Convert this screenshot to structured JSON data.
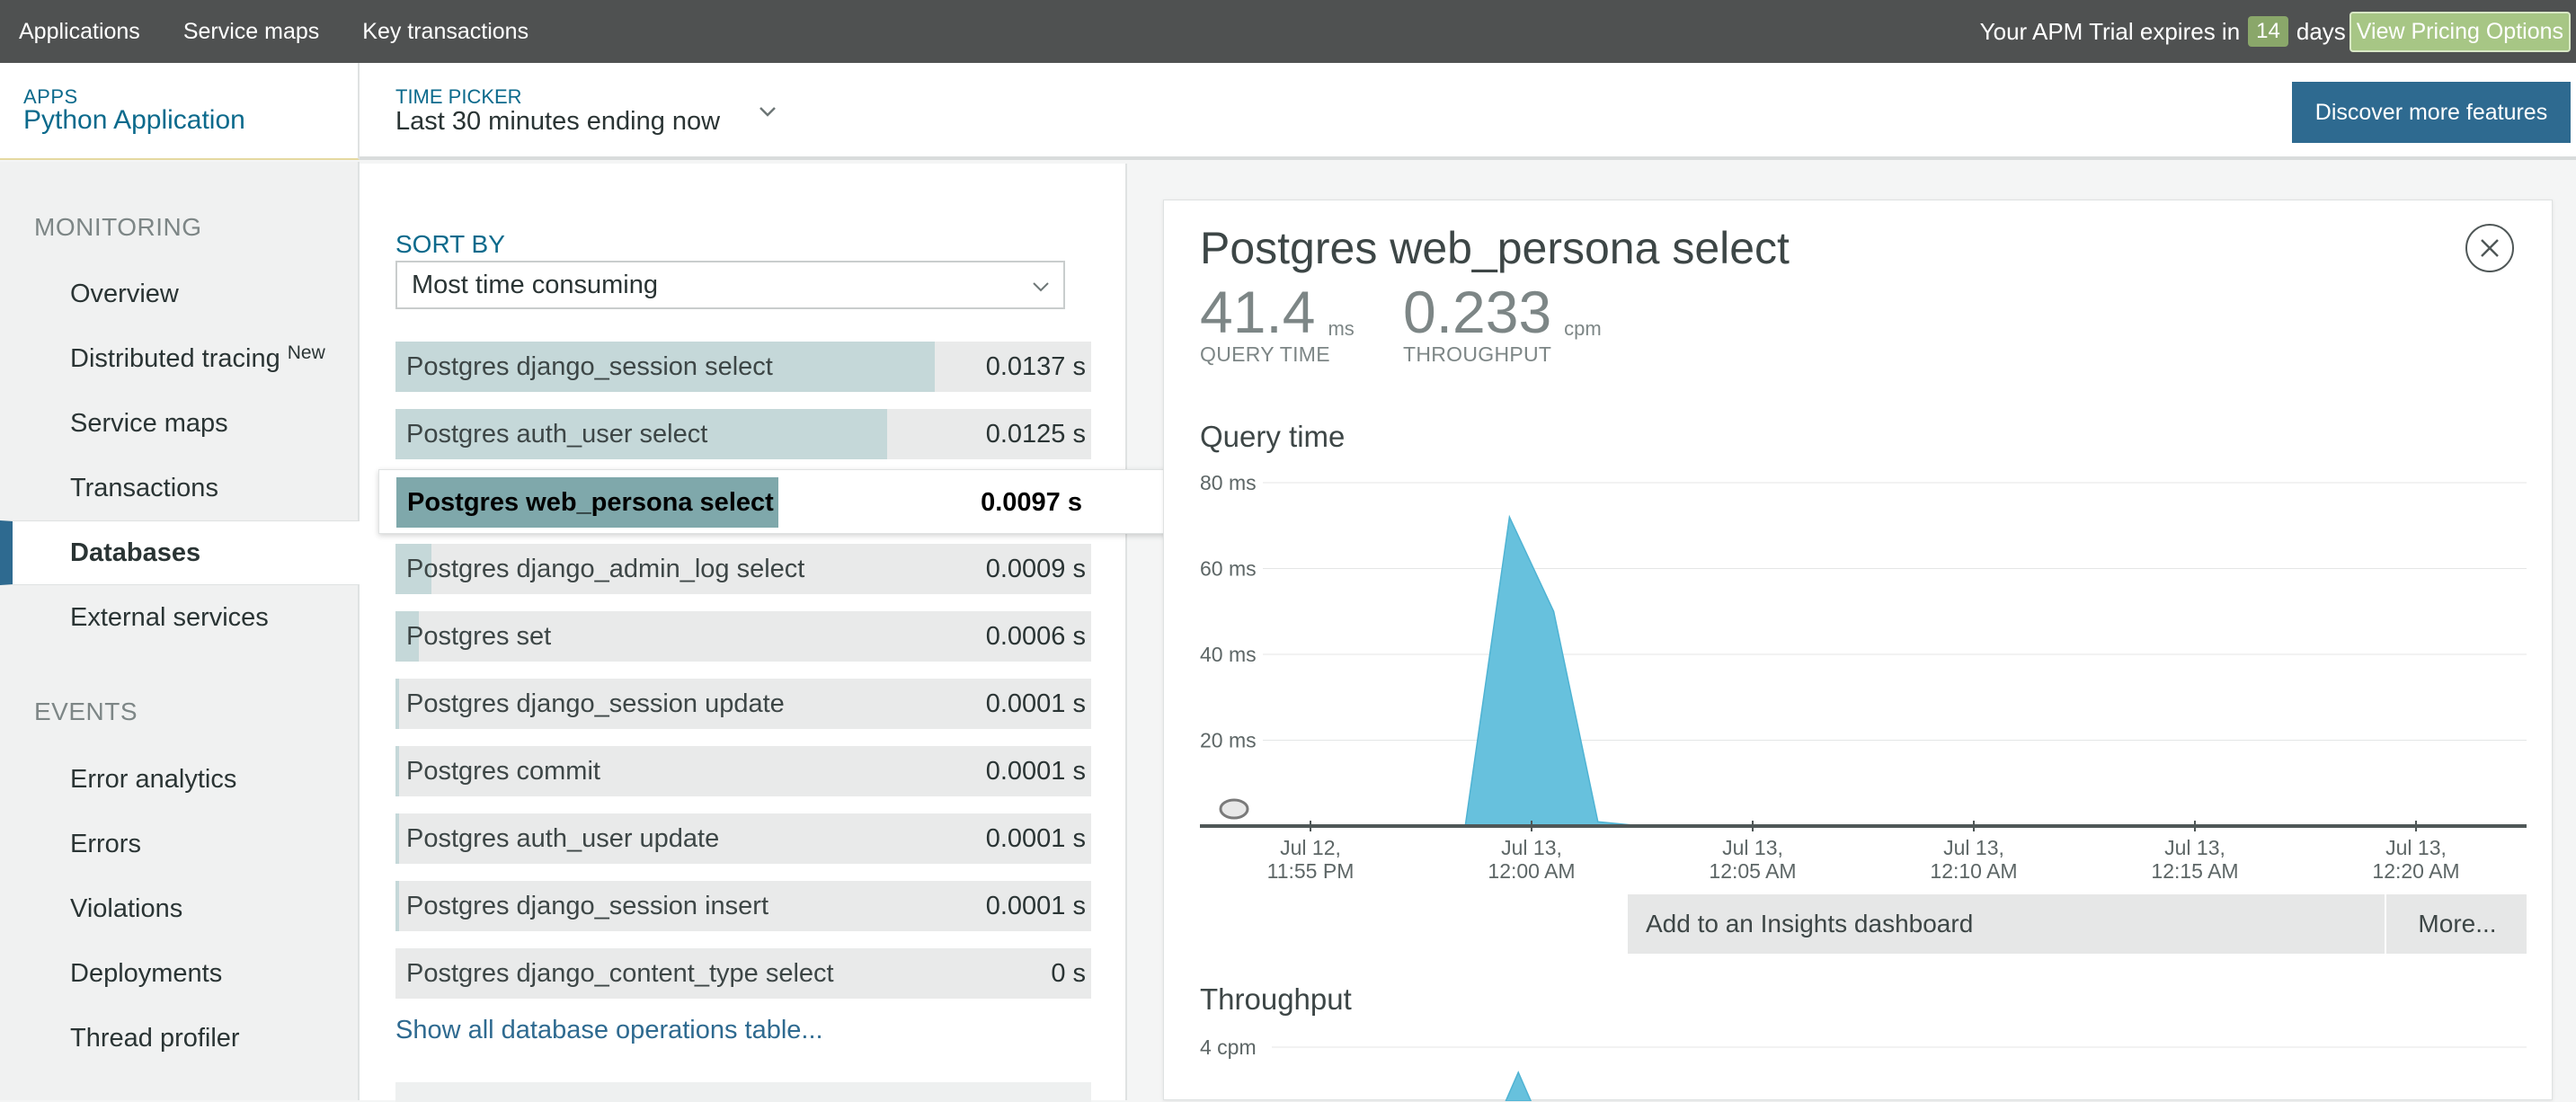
{
  "topnav": {
    "items": [
      "Applications",
      "Service maps",
      "Key transactions"
    ]
  },
  "trial": {
    "prefix": "Your APM Trial expires in",
    "days": "14",
    "suffix": "days",
    "pricing": "View Pricing Options"
  },
  "apphead": {
    "label": "APPS",
    "name": "Python Application"
  },
  "timepicker": {
    "label": "TIME PICKER",
    "value": "Last 30 minutes ending now"
  },
  "discover": "Discover more features",
  "sidebar": {
    "monitoring_label": "MONITORING",
    "monitoring": [
      {
        "label": "Overview"
      },
      {
        "label": "Distributed tracing",
        "badge": "New"
      },
      {
        "label": "Service maps"
      },
      {
        "label": "Transactions"
      },
      {
        "label": "Databases",
        "active": true
      },
      {
        "label": "External services"
      }
    ],
    "events_label": "EVENTS",
    "events": [
      {
        "label": "Error analytics"
      },
      {
        "label": "Errors"
      },
      {
        "label": "Violations"
      },
      {
        "label": "Deployments"
      },
      {
        "label": "Thread profiler"
      }
    ]
  },
  "sort": {
    "label": "SORT BY",
    "value": "Most time consuming"
  },
  "operations": [
    {
      "name": "Postgres django_session select",
      "value": "0.0137 s",
      "fraction": 1.0
    },
    {
      "name": "Postgres auth_user select",
      "value": "0.0125 s",
      "fraction": 0.912
    },
    {
      "name": "Postgres web_persona select",
      "value": "0.0097 s",
      "fraction": 0.708,
      "selected": true
    },
    {
      "name": "Postgres django_admin_log select",
      "value": "0.0009 s",
      "fraction": 0.066
    },
    {
      "name": "Postgres set",
      "value": "0.0006 s",
      "fraction": 0.044
    },
    {
      "name": "Postgres django_session update",
      "value": "0.0001 s",
      "fraction": 0.007
    },
    {
      "name": "Postgres commit",
      "value": "0.0001 s",
      "fraction": 0.007
    },
    {
      "name": "Postgres auth_user update",
      "value": "0.0001 s",
      "fraction": 0.007
    },
    {
      "name": "Postgres django_session insert",
      "value": "0.0001 s",
      "fraction": 0.007
    },
    {
      "name": "Postgres django_content_type select",
      "value": "0 s",
      "fraction": 0.0
    }
  ],
  "showall": "Show all database operations table...",
  "detail": {
    "title": "Postgres web_persona select",
    "query_time": {
      "value": "41.4",
      "unit": "ms",
      "label": "QUERY TIME"
    },
    "throughput": {
      "value": "0.233",
      "unit": "cpm",
      "label": "THROUGHPUT"
    },
    "query_chart_title": "Query time",
    "throughput_chart_title": "Throughput",
    "insights_button": "Add to an Insights dashboard",
    "more_button": "More..."
  },
  "colors": {
    "accent": "#2e6a90",
    "series": "#67c1dd",
    "topbar": "#4f5151"
  },
  "chart_data": [
    {
      "type": "area",
      "title": "Query time",
      "yticks": [
        "80 ms",
        "60 ms",
        "40 ms",
        "20 ms"
      ],
      "ylim": [
        0,
        80
      ],
      "xticks": [
        {
          "line1": "Jul 12,",
          "line2": "11:55 PM",
          "t": 0
        },
        {
          "line1": "Jul 13,",
          "line2": "12:00 AM",
          "t": 5
        },
        {
          "line1": "Jul 13,",
          "line2": "12:05 AM",
          "t": 10
        },
        {
          "line1": "Jul 13,",
          "line2": "12:10 AM",
          "t": 15
        },
        {
          "line1": "Jul 13,",
          "line2": "12:15 AM",
          "t": 20
        },
        {
          "line1": "Jul 13,",
          "line2": "12:20 AM",
          "t": 25
        }
      ],
      "xlim": [
        -2.5,
        27.5
      ],
      "series": [
        {
          "values": [
            [
              -2.5,
              0
            ],
            [
              3.5,
              0
            ],
            [
              4.5,
              72
            ],
            [
              5.5,
              50
            ],
            [
              6.5,
              1
            ],
            [
              7.5,
              0
            ],
            [
              27.5,
              0
            ]
          ]
        }
      ]
    },
    {
      "type": "area",
      "title": "Throughput",
      "yticks": [
        "4 cpm"
      ],
      "ylim": [
        0,
        4
      ]
    }
  ]
}
